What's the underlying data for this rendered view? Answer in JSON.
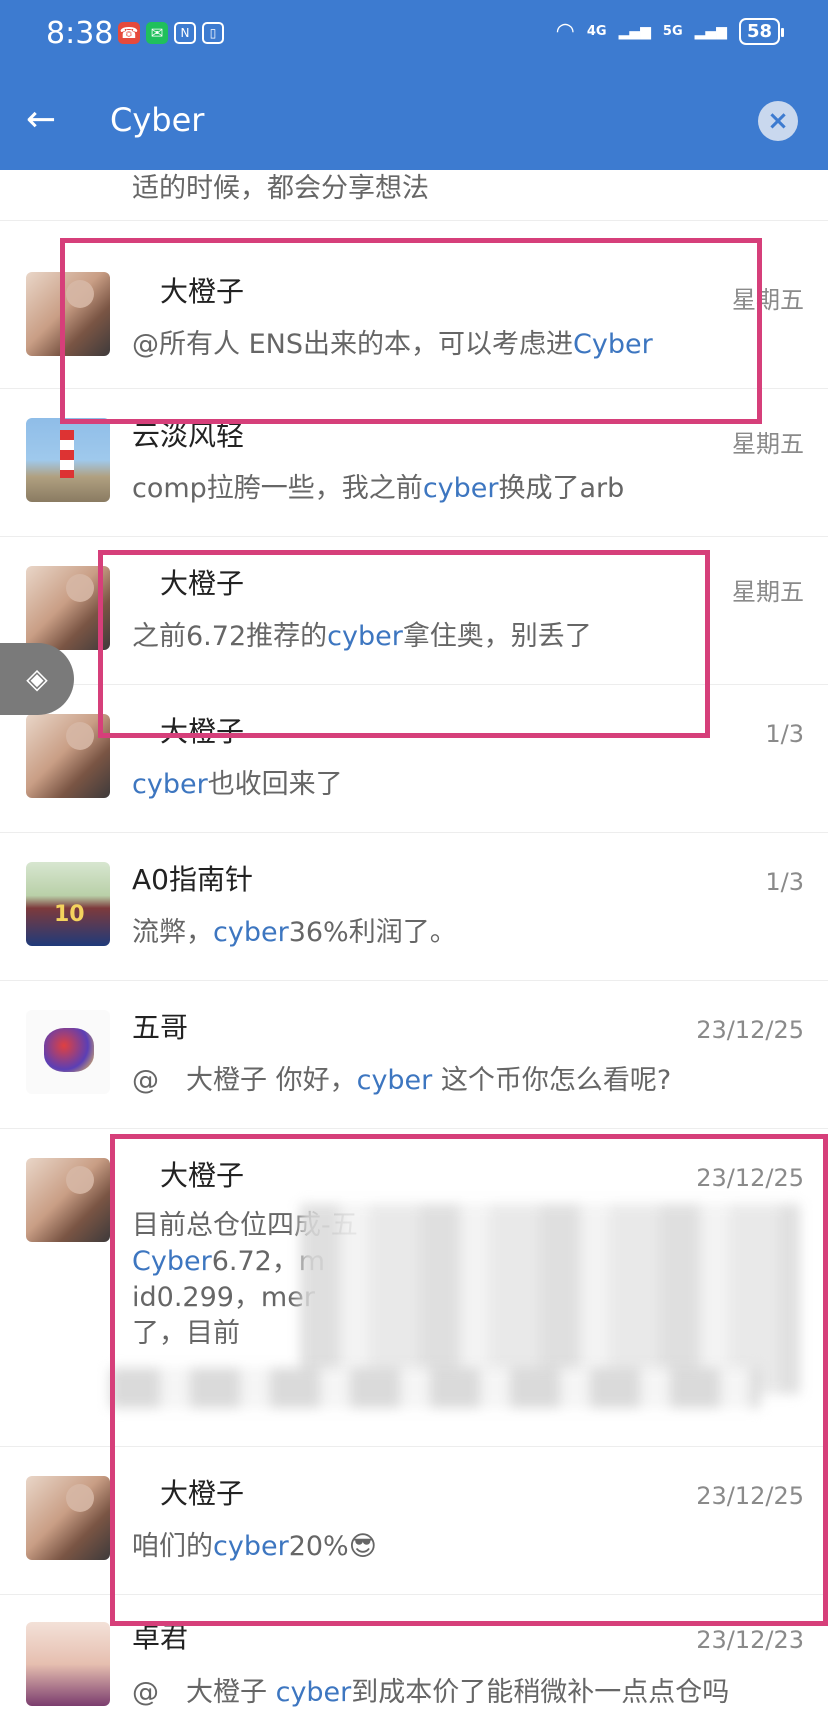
{
  "status": {
    "time": "8:38",
    "battery": "58",
    "network1": "4G",
    "network2": "5G"
  },
  "search": {
    "query": "Cyber"
  },
  "top_partial": {
    "snippet": "适的时候，都会分享想法"
  },
  "results": [
    {
      "name": "大橙子",
      "date": "星期五",
      "pre": "@所有人 ENS出来的本，可以考虑进",
      "hl": "Cyber",
      "post": ""
    },
    {
      "name": "云淡风轻",
      "date": "星期五",
      "pre": "comp拉胯一些，我之前",
      "hl": "cyber",
      "post": "换成了arb"
    },
    {
      "name": "大橙子",
      "date": "星期五",
      "pre": "之前6.72推荐的",
      "hl": "cyber",
      "post": "拿住奥，别丢了"
    },
    {
      "name": "大橙子",
      "date": "1/3",
      "pre": "",
      "hl": "cyber",
      "post": "也收回来了"
    },
    {
      "name": "A0指南针",
      "date": "1/3",
      "pre": "流弊，",
      "hl": "cyber",
      "post": "36%利润了。"
    },
    {
      "name": "五哥",
      "date": "23/12/25",
      "pre": "@　大橙子  你好，",
      "hl": "cyber",
      "post": " 这个币你怎么看呢?"
    },
    {
      "name": "大橙子",
      "date": "23/12/25",
      "line1": "目前总仓位四成-五",
      "line2_hl": "Cyber",
      "line2": "6.72，m",
      "line3": "id0.299，mer",
      "line4": "了，目前"
    },
    {
      "name": "大橙子",
      "date": "23/12/25",
      "pre": "咱们的",
      "hl": "cyber",
      "post": "20%😎"
    },
    {
      "name": "卓君",
      "date": "23/12/23",
      "pre": "@　大橙子  ",
      "hl": "cyber",
      "post": "到成本价了能稍微补一点点仓吗"
    }
  ]
}
